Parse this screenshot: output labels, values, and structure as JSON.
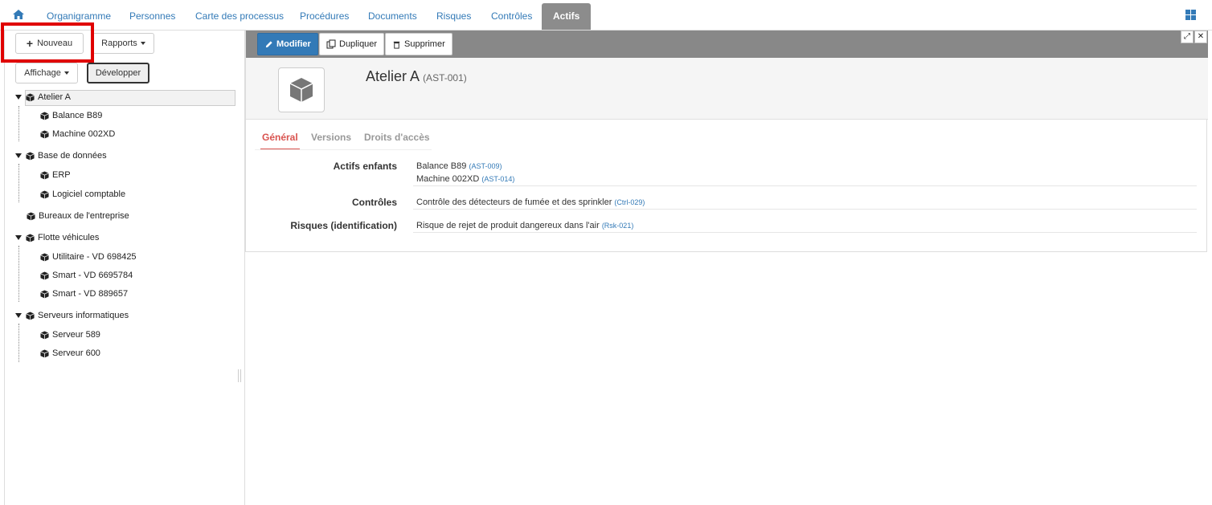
{
  "nav": {
    "tabs": [
      "Organigramme",
      "Personnes",
      "Carte des processus",
      "Procédures",
      "Documents",
      "Risques",
      "Contrôles",
      "Actifs"
    ],
    "active_tab": "Actifs",
    "home_icon": "home-icon",
    "apps_icon": "grid-icon"
  },
  "left": {
    "new_label": "Nouveau",
    "reports_label": "Rapports",
    "display_label": "Affichage",
    "expand_label": "Développer",
    "tree": [
      {
        "label": "Atelier A",
        "selected": true,
        "children": [
          "Balance B89",
          "Machine 002XD"
        ]
      },
      {
        "label": "Base de données",
        "children": [
          "ERP",
          "Logiciel comptable"
        ]
      },
      {
        "label": "Bureaux de l'entreprise",
        "children": []
      },
      {
        "label": "Flotte véhicules",
        "children": [
          "Utilitaire - VD 698425",
          "Smart - VD 6695784",
          "Smart - VD 889657"
        ]
      },
      {
        "label": "Serveurs informatiques",
        "children": [
          "Serveur 589",
          "Serveur 600"
        ]
      }
    ]
  },
  "toolbar": {
    "edit_label": "Modifier",
    "duplicate_label": "Dupliquer",
    "delete_label": "Supprimer"
  },
  "record": {
    "title": "Atelier A",
    "code": "(AST-001)"
  },
  "subtabs": [
    "Général",
    "Versions",
    "Droits d'accès"
  ],
  "fields": {
    "children_label": "Actifs enfants",
    "children": [
      {
        "name": "Balance B89",
        "ref": "(AST-009)"
      },
      {
        "name": "Machine 002XD",
        "ref": "(AST-014)"
      }
    ],
    "controls_label": "Contrôles",
    "control": {
      "name": "Contrôle des détecteurs de fumée et des sprinkler",
      "ref": "(Ctrl-029)"
    },
    "risks_label": "Risques (identification)",
    "risk": {
      "name": "Risque de rejet de produit dangereux dans l'air",
      "ref": "(Rsk-021)"
    }
  },
  "colors": {
    "primary": "#337ab7",
    "active_tab_bg": "#8c8c8c",
    "highlight": "#e00000",
    "subtab_active": "#d9534f"
  }
}
